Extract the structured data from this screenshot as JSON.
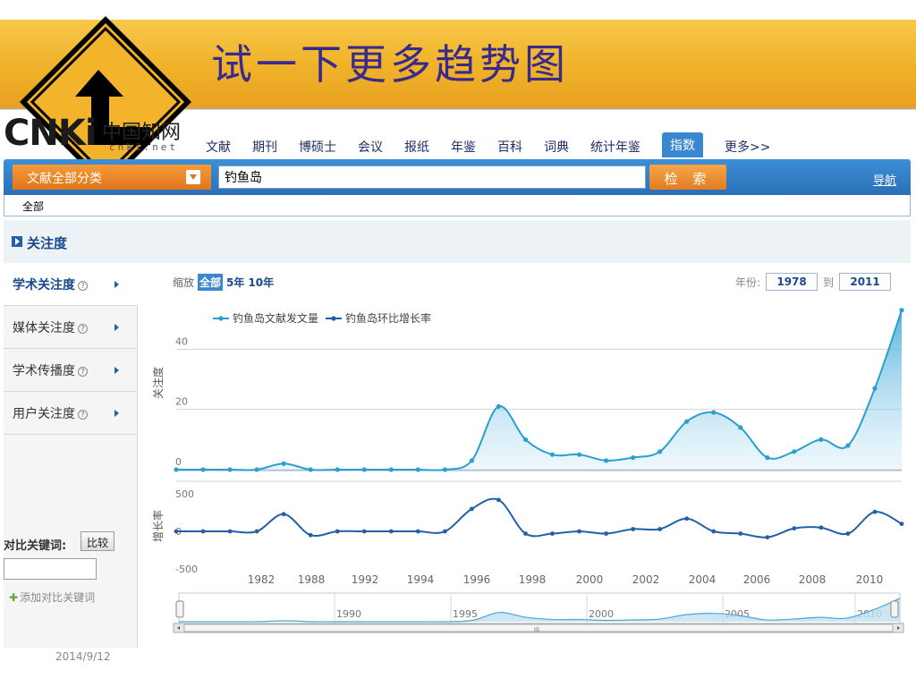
{
  "slide": {
    "title": "试一下更多趋势图",
    "date": "2014/9/12"
  },
  "logo": {
    "latin": "CNKi",
    "chinese": "中国知网",
    "domain": "cnki.net"
  },
  "nav": {
    "items": [
      "文献",
      "期刊",
      "博硕士",
      "会议",
      "报纸",
      "年鉴",
      "百科",
      "词典",
      "统计年鉴",
      "指数",
      "更多>>"
    ],
    "active_index": 9
  },
  "search": {
    "category": "文献全部分类",
    "value": "钓鱼岛",
    "button": "检 索",
    "guide_link": "导航"
  },
  "breadcrumb": "全部",
  "section": {
    "title": "关注度"
  },
  "sidebar": {
    "tabs": [
      {
        "label": "学术关注度",
        "active": true
      },
      {
        "label": "媒体关注度",
        "active": false
      },
      {
        "label": "学术传播度",
        "active": false
      },
      {
        "label": "用户关注度",
        "active": false
      }
    ],
    "help_glyph": "?",
    "compare_label": "对比关键词:",
    "compare_button": "比较",
    "add_keyword": "添加对比关键词"
  },
  "controls": {
    "zoom_label": "缩放",
    "zoom_options": [
      "全部",
      "5年",
      "10年"
    ],
    "year_label": "年份:",
    "year_from": "1978",
    "year_to_word": "到",
    "year_to": "2011"
  },
  "chart_data": {
    "type": "line",
    "legend": [
      "钓鱼岛文献发文量",
      "钓鱼岛环比增长率"
    ],
    "x_tick_labels": [
      "1982",
      "1988",
      "1992",
      "1994",
      "1996",
      "1998",
      "2000",
      "2002",
      "2004",
      "2006",
      "2008",
      "2010"
    ],
    "upper": {
      "ylabel": "关注度",
      "yticks": [
        "0",
        "20",
        "40"
      ],
      "ylim": [
        0,
        55
      ],
      "series_name": "钓鱼岛文献发文量",
      "values": [
        0,
        0,
        0,
        0,
        2,
        0,
        0,
        0,
        0,
        0,
        0,
        3,
        21,
        10,
        5,
        5,
        3,
        4,
        6,
        16,
        19,
        14,
        4,
        6,
        10,
        8,
        27,
        53
      ]
    },
    "lower": {
      "ylabel": "增长率",
      "yticks": [
        "500",
        "0",
        "-500"
      ],
      "ylim": [
        -550,
        550
      ],
      "series_name": "钓鱼岛环比增长率",
      "values": [
        0,
        0,
        0,
        0,
        230,
        -50,
        0,
        0,
        0,
        0,
        0,
        300,
        420,
        -30,
        -30,
        0,
        -30,
        30,
        30,
        170,
        0,
        -30,
        -80,
        40,
        50,
        -30,
        260,
        100
      ]
    },
    "navigator_labels": [
      "1990",
      "1995",
      "2000",
      "2005",
      "2010"
    ],
    "scrollbar_glyph": "III"
  },
  "colors": {
    "banner": "#f1b52d",
    "title": "#3a2a8c",
    "accent": "#2a6fb7",
    "orange": "#e27d22",
    "line": "#2a9fd0",
    "line_dark": "#2160a8"
  }
}
